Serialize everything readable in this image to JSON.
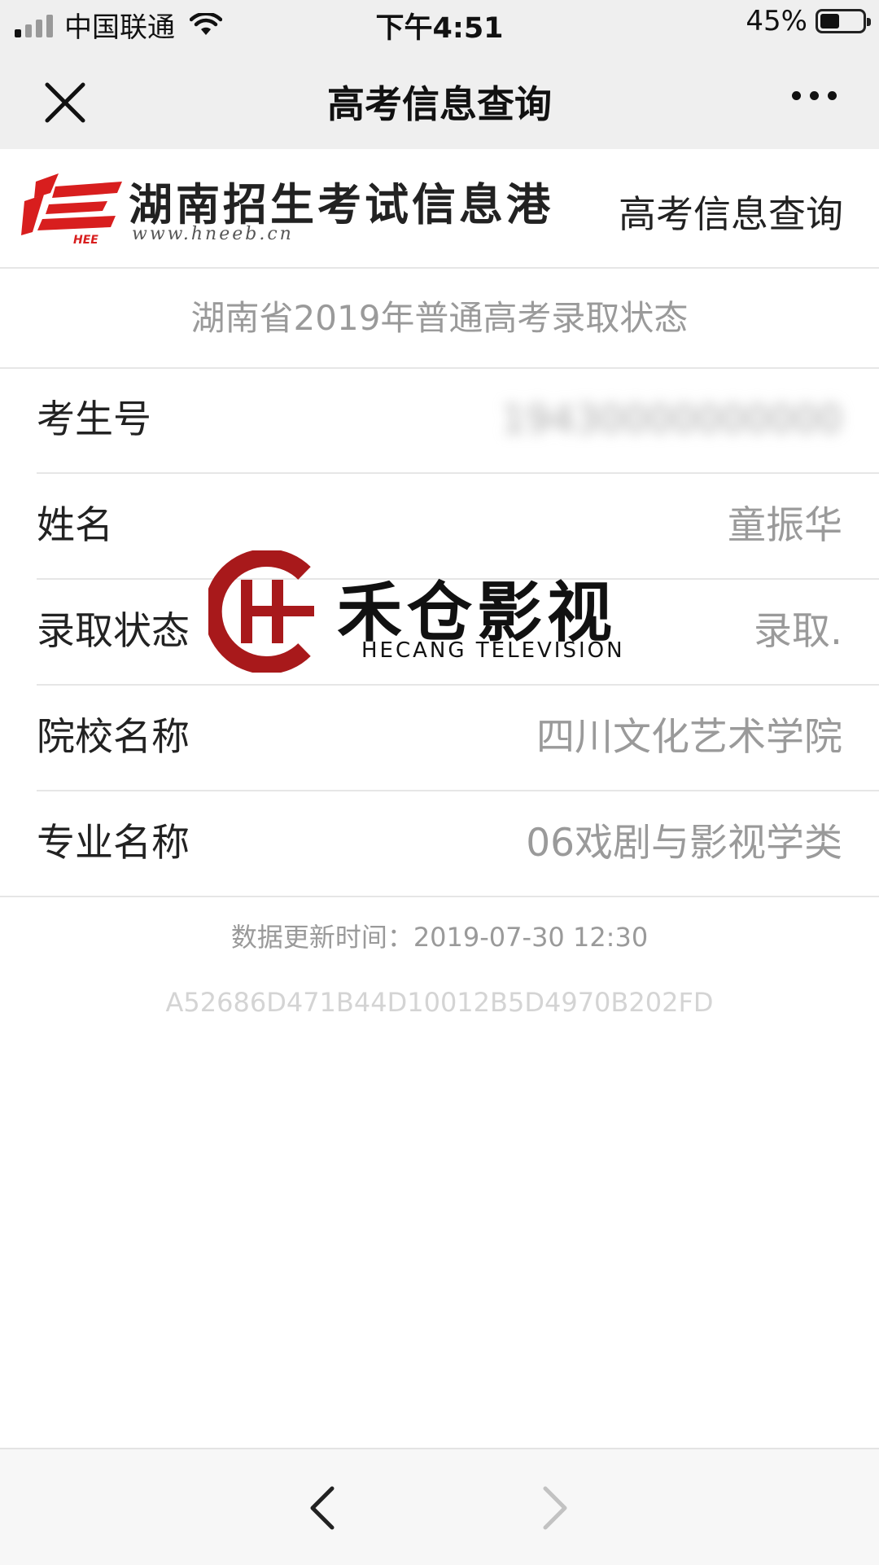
{
  "status_bar": {
    "carrier": "中国联通",
    "time": "下午4:51",
    "battery_percent": "45%",
    "battery_level": 0.45
  },
  "nav": {
    "title": "高考信息查询",
    "close_icon": "close-icon",
    "more_icon": "more-icon"
  },
  "site_header": {
    "site_name": "湖南招生考试信息港",
    "site_url": "www.hneeb.cn",
    "logo_text": "HEE",
    "link_label": "高考信息查询"
  },
  "result": {
    "title": "湖南省2019年普通高考录取状态",
    "rows": [
      {
        "label": "考生号",
        "value": "19430000000000"
      },
      {
        "label": "姓名",
        "value": "童振华"
      },
      {
        "label": "录取状态",
        "value": "录取."
      },
      {
        "label": "院校名称",
        "value": "四川文化艺术学院"
      },
      {
        "label": "专业名称",
        "value": "06戏剧与影视学类"
      }
    ],
    "update_time": "数据更新时间：2019-07-30 12:30",
    "hash": "A52686D471B44D10012B5D4970B202FD"
  },
  "watermark": {
    "name": "禾仓影视",
    "subtitle": "HECANG TELEVISION"
  },
  "toolbar": {
    "back_icon": "chevron-left-icon",
    "forward_icon": "chevron-right-icon"
  },
  "colors": {
    "brand_red": "#d81e1e",
    "watermark_red": "#a8191b",
    "muted_text": "#9a9a9a"
  }
}
